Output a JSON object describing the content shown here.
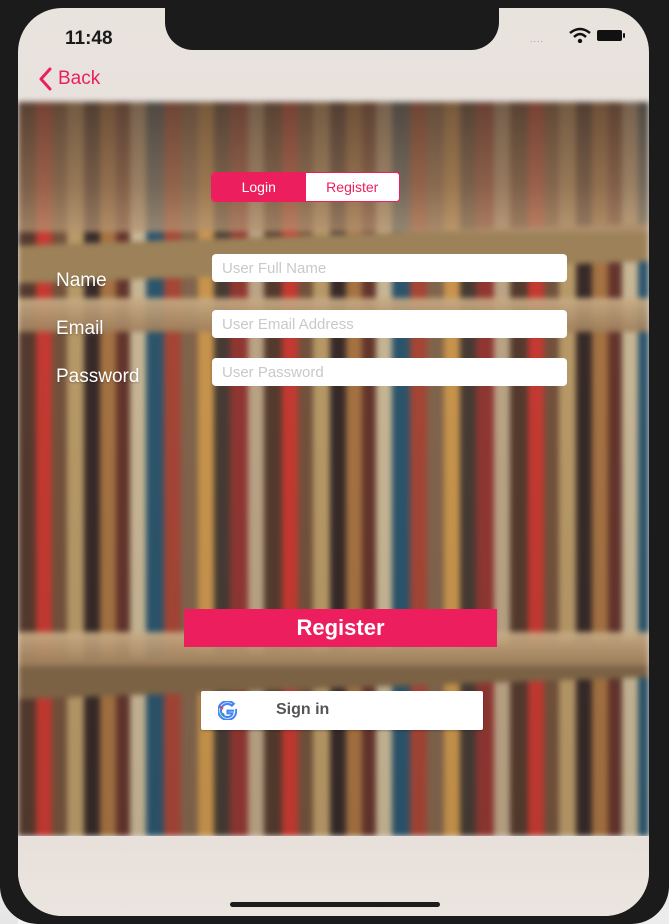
{
  "status_bar": {
    "time": "11:48",
    "signal": "....",
    "wifi_icon": "wifi-icon",
    "battery_icon": "battery-icon"
  },
  "nav": {
    "back_label": "Back",
    "back_icon": "chevron-left-icon"
  },
  "segmented_control": {
    "segments": [
      {
        "label": "Login",
        "selected": true
      },
      {
        "label": "Register",
        "selected": false
      }
    ]
  },
  "form": {
    "fields": [
      {
        "label": "Name",
        "value": "",
        "placeholder": "User Full Name"
      },
      {
        "label": "Email",
        "value": "",
        "placeholder": "User Email Address"
      },
      {
        "label": "Password",
        "value": "",
        "placeholder": "User Password"
      }
    ]
  },
  "actions": {
    "register_label": "Register",
    "google_signin_label": "Sign in",
    "google_icon": "google-icon"
  },
  "colors": {
    "accent": "#ec1e5d",
    "input_background": "#ffffff",
    "label_text": "#ffffff"
  }
}
